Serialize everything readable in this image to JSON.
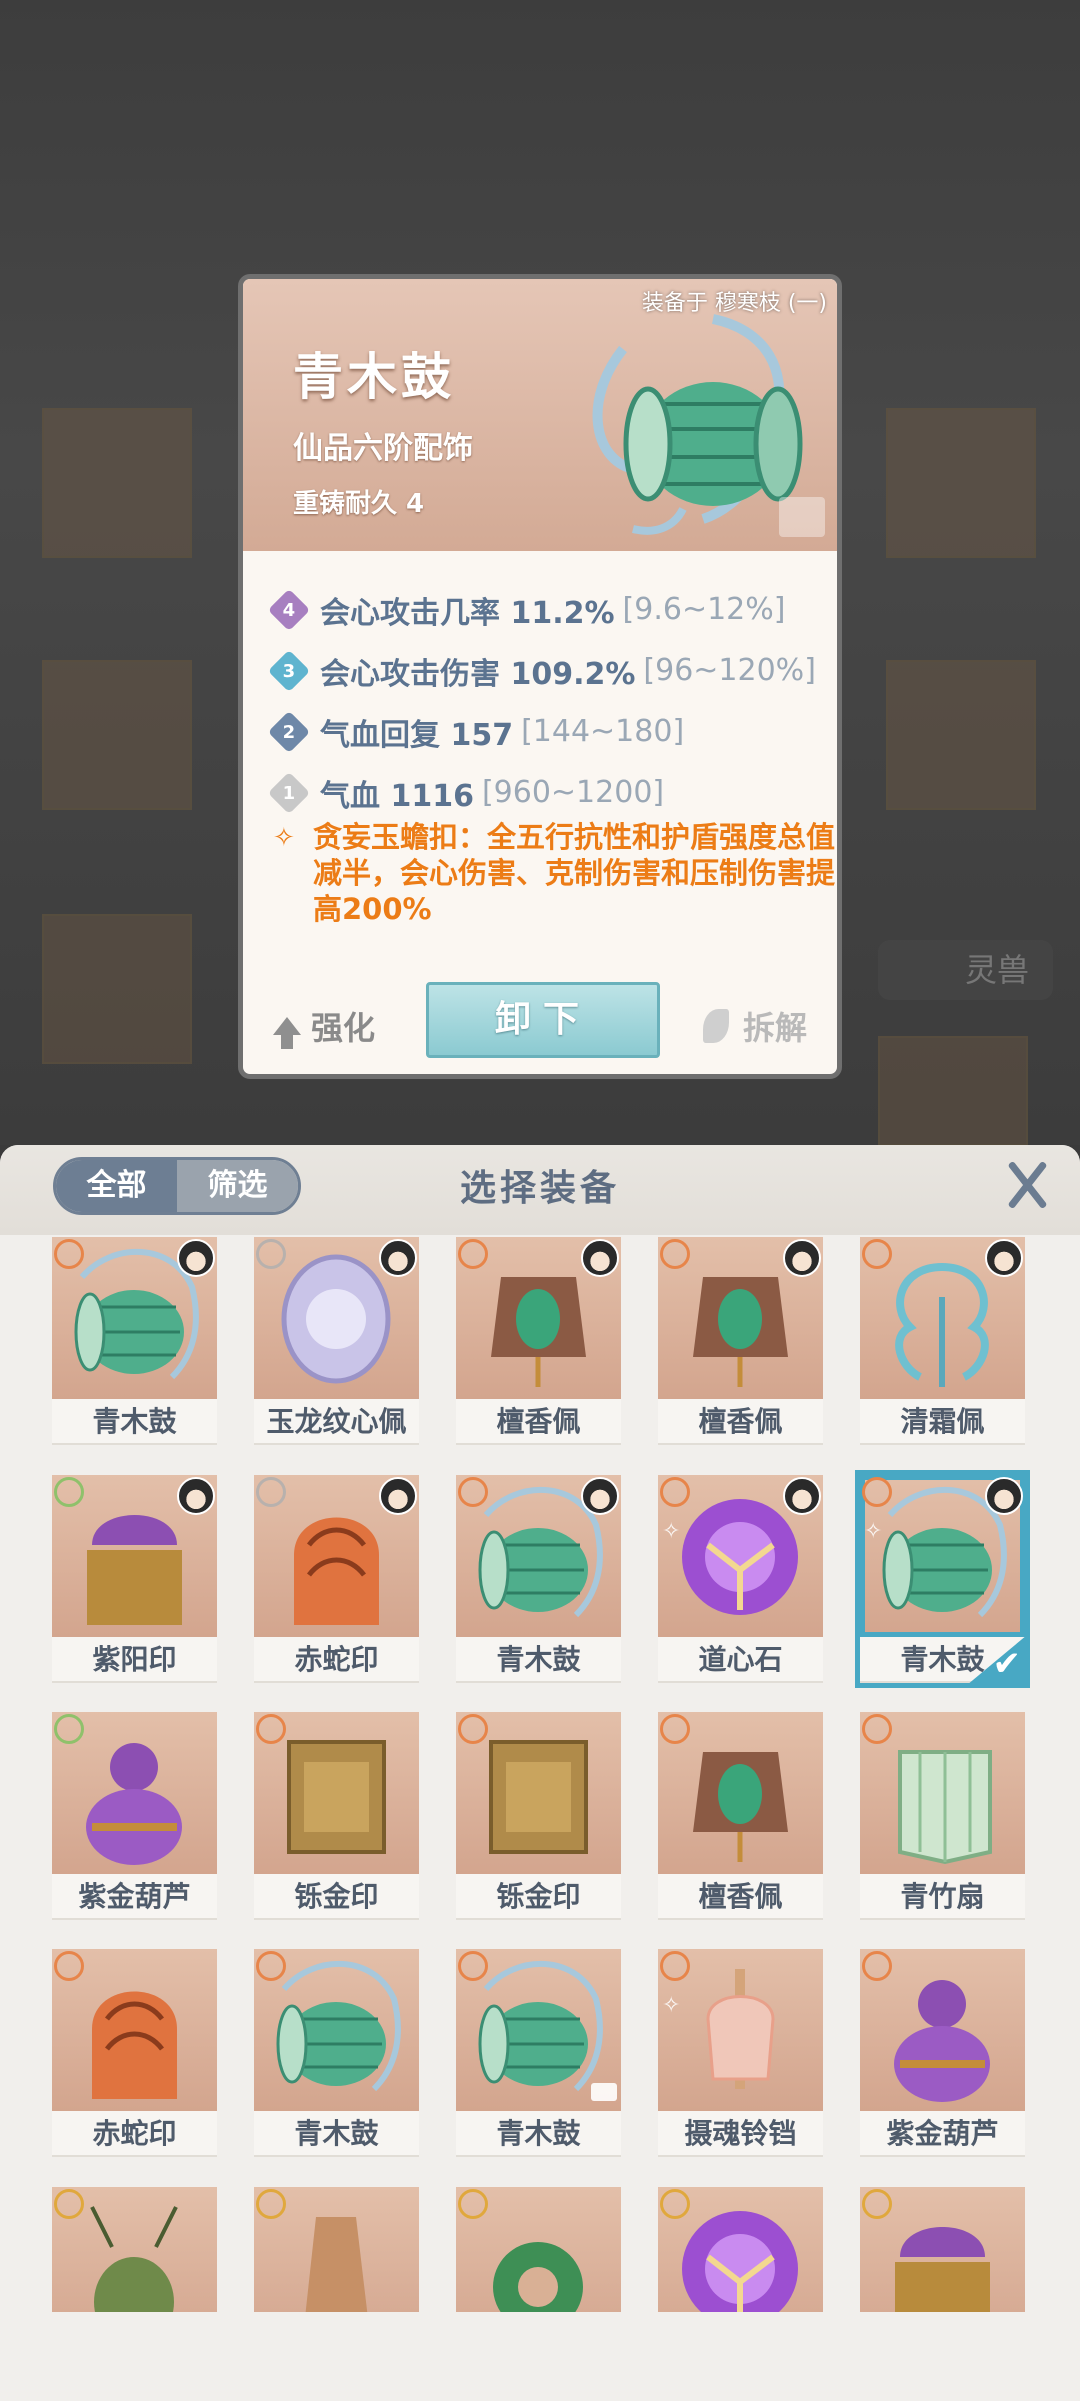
{
  "background": {
    "side_label": "灵兽"
  },
  "detail_card": {
    "equipped_to": "装备于 穆寒枝 (一)",
    "name": "青木鼓",
    "grade": "仙品六阶配饰",
    "reforge": "重铸耐久 4",
    "stats": [
      {
        "badge": "4",
        "badge_color": "#a77fc0",
        "text": "会心攻击几率 11.2%",
        "range": "[9.6~12%]"
      },
      {
        "badge": "3",
        "badge_color": "#5fb4cf",
        "text": "会心攻击伤害 109.2%",
        "range": "[96~120%]"
      },
      {
        "badge": "2",
        "badge_color": "#6e88a8",
        "text": "气血回复 157",
        "range": "[144~180]"
      },
      {
        "badge": "1",
        "badge_color": "#c8c8c8",
        "text": "气血 1116",
        "range": "[960~1200]"
      }
    ],
    "effect": "贪妄玉蟾扣：全五行抗性和护盾强度总值减半，会心伤害、克制伤害和压制伤害提高200%",
    "buttons": {
      "strengthen": "强化",
      "unequip": "卸下",
      "dismantle": "拆解"
    }
  },
  "panel": {
    "tabs": [
      "全部",
      "筛选"
    ],
    "title": "选择装备",
    "items": [
      {
        "name": "青木鼓",
        "grade": "orange",
        "art": "drum",
        "avatar": true
      },
      {
        "name": "玉龙纹心佩",
        "grade": "silver",
        "art": "jade",
        "avatar": true
      },
      {
        "name": "檀香佩",
        "grade": "orange",
        "art": "pendant",
        "avatar": true
      },
      {
        "name": "檀香佩",
        "grade": "orange",
        "art": "pendant",
        "avatar": true
      },
      {
        "name": "清霜佩",
        "grade": "orange",
        "art": "frost",
        "avatar": true
      },
      {
        "name": "紫阳印",
        "grade": "green",
        "art": "seal-purple",
        "avatar": true
      },
      {
        "name": "赤蛇印",
        "grade": "silver",
        "art": "snake",
        "avatar": true
      },
      {
        "name": "青木鼓",
        "grade": "orange",
        "art": "drum",
        "avatar": true
      },
      {
        "name": "道心石",
        "grade": "orange",
        "art": "orb",
        "avatar": true,
        "swirl": true
      },
      {
        "name": "青木鼓",
        "grade": "orange",
        "art": "drum",
        "avatar": true,
        "selected": true,
        "swirl": true
      },
      {
        "name": "紫金葫芦",
        "grade": "green",
        "art": "gourd"
      },
      {
        "name": "铄金印",
        "grade": "orange",
        "art": "seal-gold"
      },
      {
        "name": "铄金印",
        "grade": "orange",
        "art": "seal-gold"
      },
      {
        "name": "檀香佩",
        "grade": "orange",
        "art": "pendant"
      },
      {
        "name": "青竹扇",
        "grade": "orange",
        "art": "fan"
      },
      {
        "name": "赤蛇印",
        "grade": "orange",
        "art": "snake"
      },
      {
        "name": "青木鼓",
        "grade": "orange",
        "art": "drum"
      },
      {
        "name": "青木鼓",
        "grade": "orange",
        "art": "drum",
        "tag": true
      },
      {
        "name": "摄魂铃铛",
        "grade": "orange",
        "art": "bell",
        "swirl": true
      },
      {
        "name": "紫金葫芦",
        "grade": "orange",
        "art": "gourd"
      },
      {
        "name": "",
        "grade": "gold",
        "art": "beetle"
      },
      {
        "name": "",
        "grade": "gold",
        "art": "vase"
      },
      {
        "name": "",
        "grade": "gold",
        "art": "ring"
      },
      {
        "name": "",
        "grade": "gold",
        "art": "orb"
      },
      {
        "name": "",
        "grade": "gold",
        "art": "seal-purple"
      }
    ]
  }
}
